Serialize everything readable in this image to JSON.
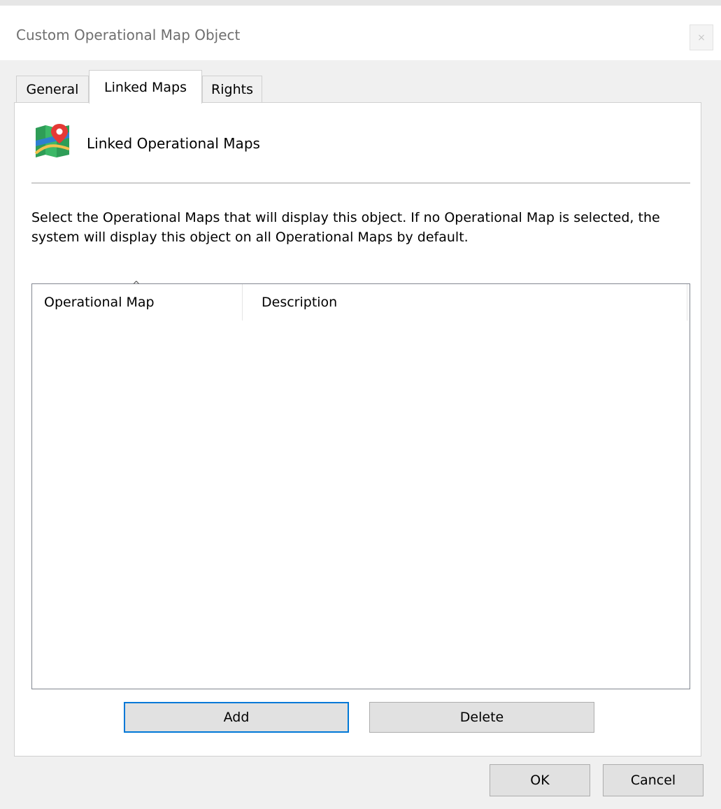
{
  "window": {
    "title": "Custom Operational Map Object",
    "close_glyph": "×"
  },
  "tabs": [
    {
      "label": "General",
      "active": false
    },
    {
      "label": "Linked Maps",
      "active": true
    },
    {
      "label": "Rights",
      "active": false
    }
  ],
  "panel": {
    "icon": "map-pin-icon",
    "title": "Linked Operational Maps",
    "instructions": "Select the Operational Maps that will display this object. If no Operational Map is selected, the system will display this object on all Operational Maps by default.",
    "list": {
      "columns": [
        "Operational Map",
        "Description"
      ],
      "sort_indicator": "^",
      "rows": []
    },
    "add_label": "Add",
    "delete_label": "Delete"
  },
  "footer": {
    "ok_label": "OK",
    "cancel_label": "Cancel"
  },
  "colors": {
    "focus_border": "#0078d7",
    "dialog_bg": "#f0f0f0"
  }
}
